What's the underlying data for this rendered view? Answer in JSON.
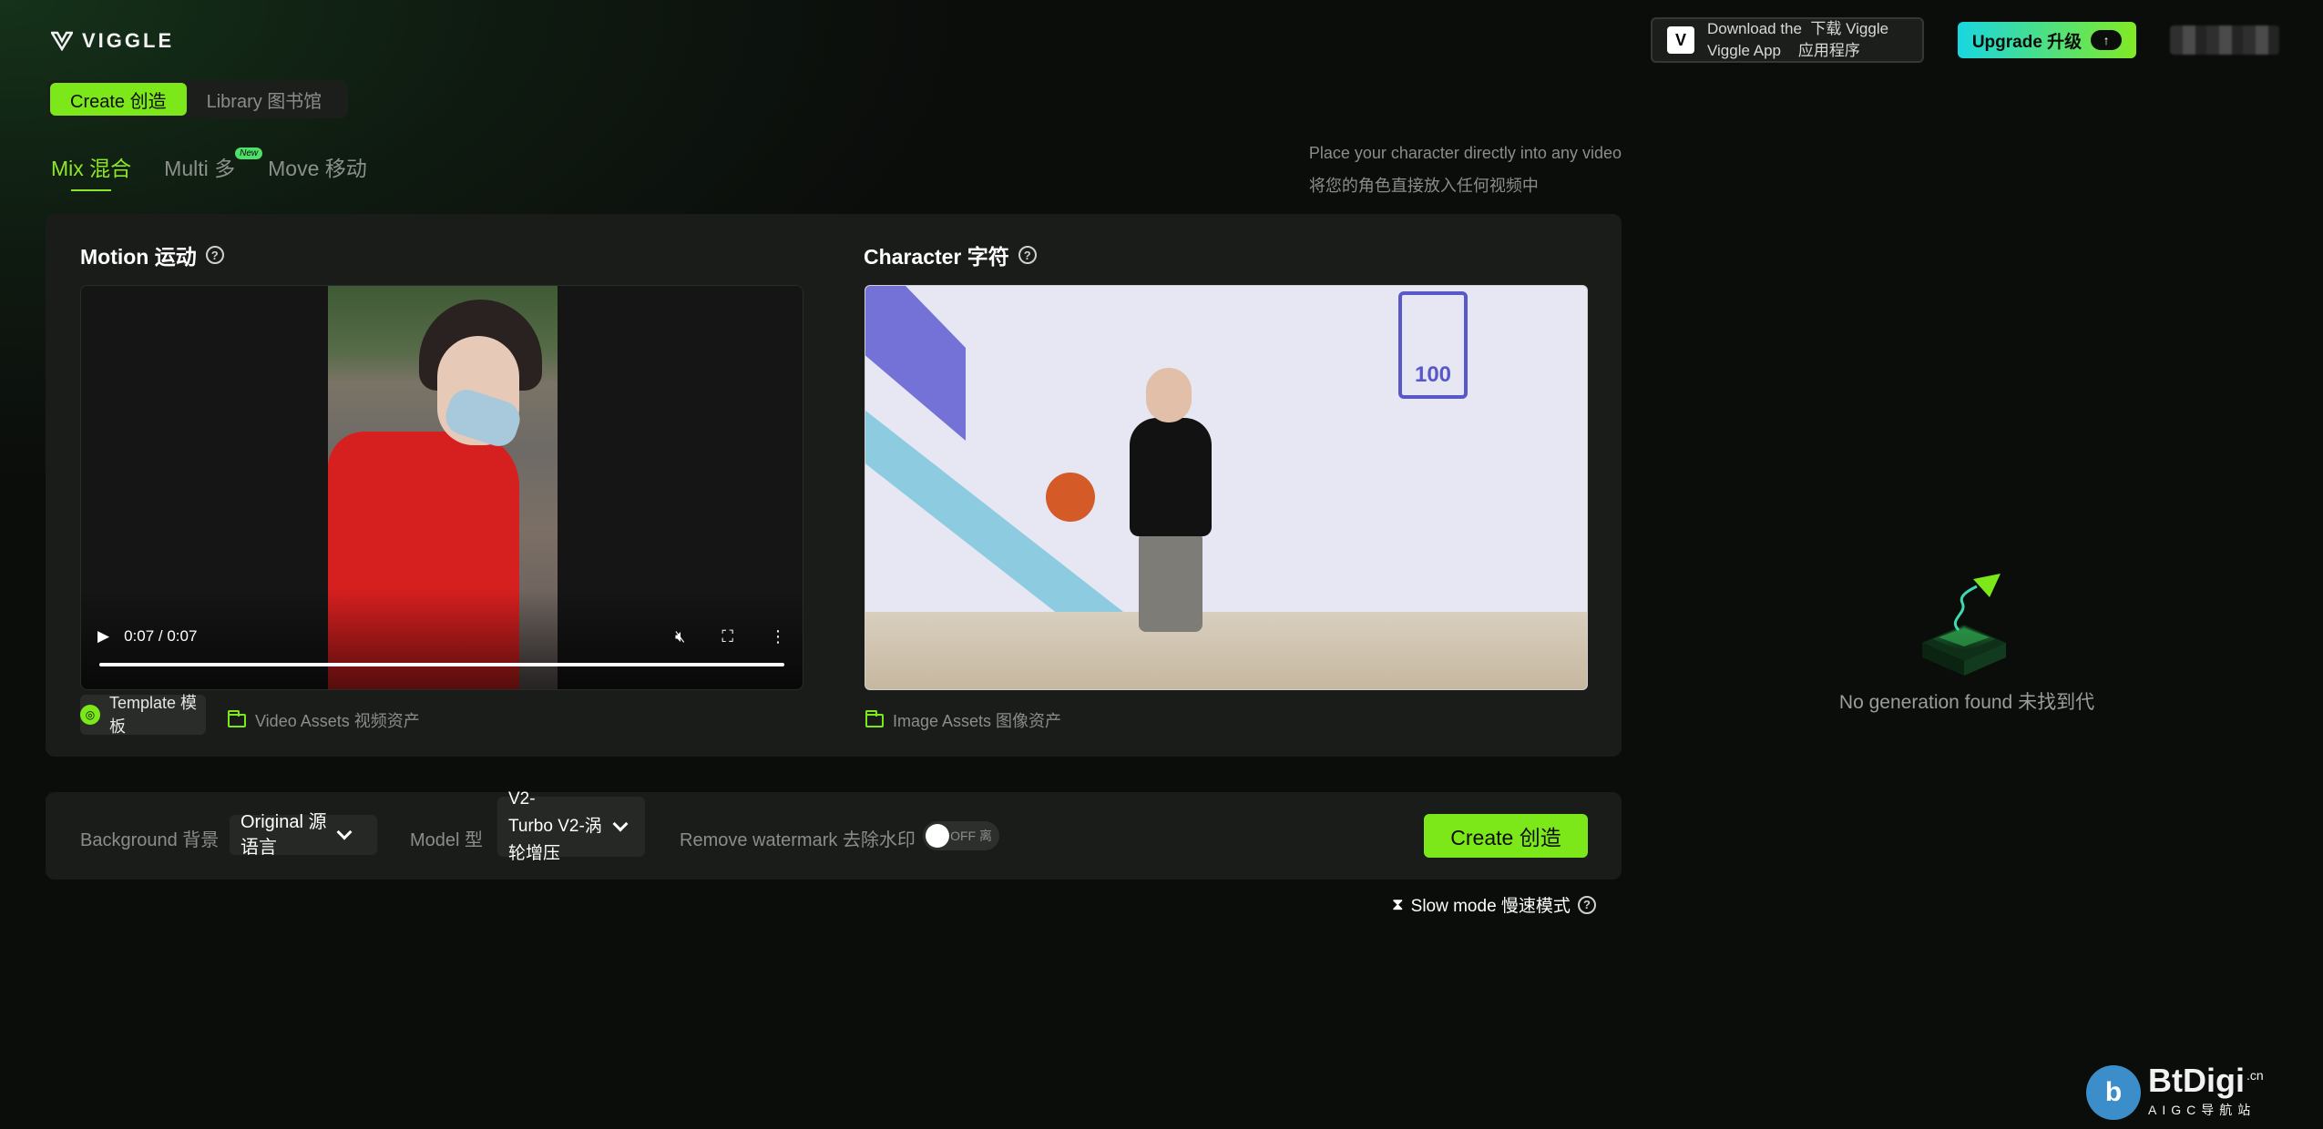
{
  "header": {
    "logo_text": "VIGGLE",
    "download_line1": "Download the  下载 Viggle",
    "download_line2": "Viggle App    应用程序",
    "upgrade_label": "Upgrade 升级"
  },
  "top_tabs": [
    {
      "label": "Create 创造",
      "active": true
    },
    {
      "label": "Library 图书馆",
      "active": false
    }
  ],
  "mode_tabs": [
    {
      "label": "Mix 混合",
      "active": true
    },
    {
      "label": "Multi 多",
      "badge": "New"
    },
    {
      "label": "Move 移动"
    }
  ],
  "description": {
    "line1": "Place your character directly into any video",
    "line2": "将您的角色直接放入任何视频中"
  },
  "motion": {
    "title": "Motion 运动",
    "time": "0:07 / 0:07",
    "template_label_1": "Template 模",
    "template_label_2": "板",
    "assets_label": "Video Assets 视频资产"
  },
  "character": {
    "title": "Character 字符",
    "assets_label": "Image Assets 图像资产",
    "sign_text": "100"
  },
  "settings": {
    "background_label": "Background 背景",
    "background_value_1": "Original 源",
    "background_value_2": "语言",
    "model_label": "Model 型",
    "model_value_1": "V2-",
    "model_value_2": "Turbo V2-涡",
    "model_value_3": "轮增压",
    "watermark_label": "Remove watermark 去除水印",
    "toggle_text": "OFF 离",
    "create_label": "Create 创造",
    "slow_mode_label": "Slow mode 慢速模式"
  },
  "results": {
    "empty_text": "No generation found 未找到代"
  },
  "watermark": {
    "brand": "BtDigi",
    "domain": ".cn",
    "sub": "AIGC导航站"
  },
  "colors": {
    "accent": "#7ce81a",
    "panel": "#1a1c1a",
    "background": "#0b0d0b"
  }
}
